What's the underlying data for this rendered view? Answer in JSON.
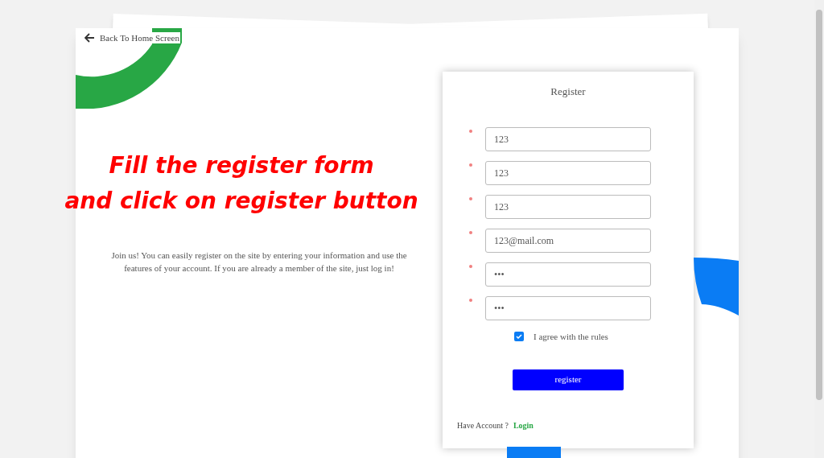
{
  "back_link": {
    "label": "Back To Home Screen"
  },
  "overlay_lines": [
    "Fill the register form",
    "and click on register button"
  ],
  "intro": "Join us! You can easily register on the site by entering your information and use the features of your account. If you are already a member of the site, just log in!",
  "form": {
    "title": "Register",
    "fields": [
      {
        "value": "123",
        "required": true
      },
      {
        "value": "123",
        "required": true
      },
      {
        "value": "123",
        "required": true
      },
      {
        "value": "123@mail.com",
        "required": true
      },
      {
        "value": "•••",
        "required": true
      },
      {
        "value": "•••",
        "required": true
      }
    ],
    "agree": {
      "label": "I agree with the rules",
      "checked": true
    },
    "submit": "register",
    "footer": {
      "text": "Have Account ?",
      "link": "Login"
    }
  }
}
